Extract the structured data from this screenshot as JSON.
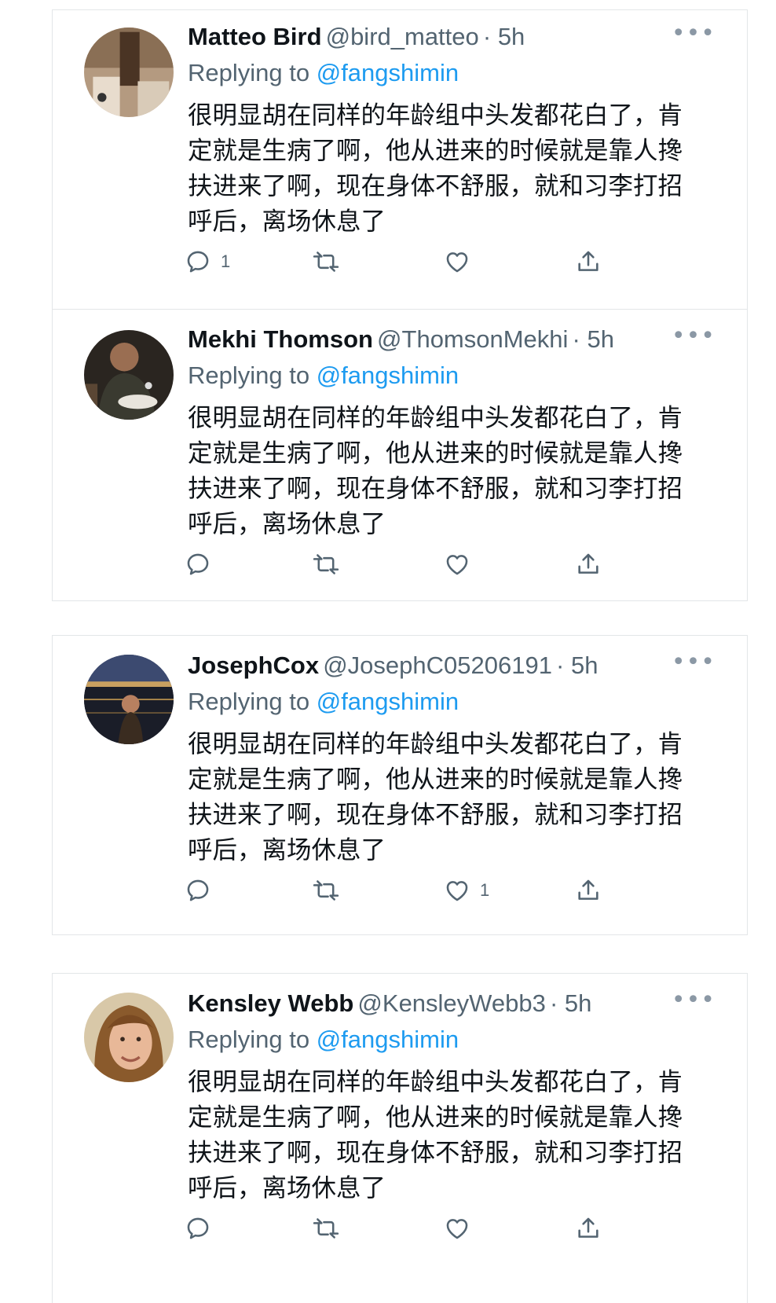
{
  "colors": {
    "accent": "#1d9bf0",
    "text": "#0f1419",
    "muted": "#536471",
    "border": "#e3e6e8"
  },
  "tweets": [
    {
      "name": "Matteo Bird",
      "handle": "@bird_matteo",
      "time": "5h",
      "reply_prefix": "Replying to",
      "reply_mention": "@fangshimin",
      "text": "很明显胡在同样的年龄组中头发都花白了，肯定就是生病了啊，他从进来的时候就是靠人搀扶进来了啊，现在身体不舒服，就和习李打招呼后，离场休息了",
      "reply_count": "1",
      "retweet_count": "",
      "like_count": "",
      "avatar_icon": "avatar-photo-mirror"
    },
    {
      "name": "Mekhi Thomson",
      "handle": "@ThomsonMekhi",
      "time": "5h",
      "reply_prefix": "Replying to",
      "reply_mention": "@fangshimin",
      "text": "很明显胡在同样的年龄组中头发都花白了，肯定就是生病了啊，他从进来的时候就是靠人搀扶进来了啊，现在身体不舒服，就和习李打招呼后，离场休息了",
      "reply_count": "",
      "retweet_count": "",
      "like_count": "",
      "avatar_icon": "avatar-photo-dining"
    },
    {
      "name": "JosephCox",
      "handle": "@JosephC05206191",
      "time": "5h",
      "reply_prefix": "Replying to",
      "reply_mention": "@fangshimin",
      "text": "很明显胡在同样的年龄组中头发都花白了，肯定就是生病了啊，他从进来的时候就是靠人搀扶进来了啊，现在身体不舒服，就和习李打招呼后，离场休息了",
      "reply_count": "",
      "retweet_count": "",
      "like_count": "1",
      "avatar_icon": "avatar-photo-night-river"
    },
    {
      "name": "Kensley Webb",
      "handle": "@KensleyWebb3",
      "time": "5h",
      "reply_prefix": "Replying to",
      "reply_mention": "@fangshimin",
      "text": "很明显胡在同样的年龄组中头发都花白了，肯定就是生病了啊，他从进来的时候就是靠人搀扶进来了啊，现在身体不舒服，就和习李打招呼后，离场休息了",
      "reply_count": "",
      "retweet_count": "",
      "like_count": "",
      "avatar_icon": "avatar-photo-portrait"
    }
  ]
}
